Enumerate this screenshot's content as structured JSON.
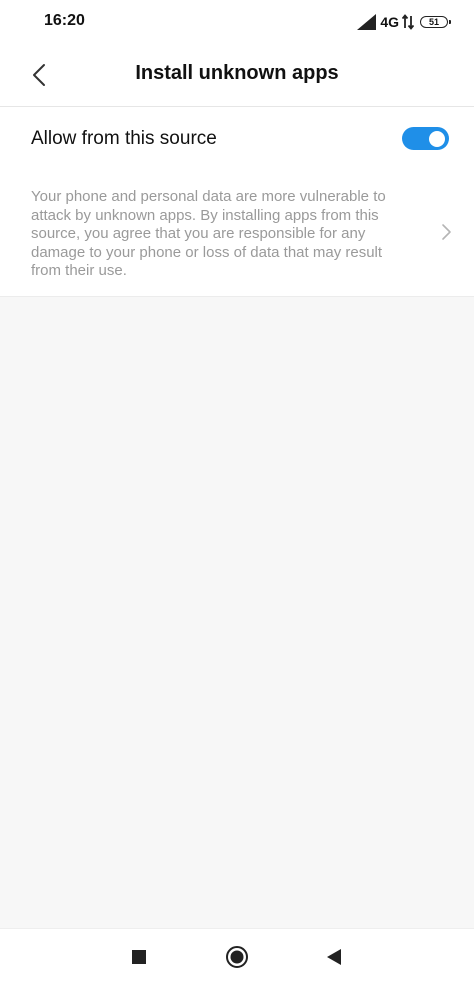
{
  "status_bar": {
    "time": "16:20",
    "network": "4G",
    "battery": "51"
  },
  "header": {
    "title": "Install unknown apps",
    "back_icon": "chevron-left-icon"
  },
  "settings": {
    "toggle_label": "Allow from this source",
    "toggle_on": true,
    "toggle_color": "#1f8fe8",
    "warning_text": "Your phone and personal data are more vulnerable to attack by unknown apps. By installing apps from this source, you agree that you are responsible for any damage to your phone or loss of data that may result from their use."
  },
  "nav_bar": {
    "icons": [
      "square-recents-icon",
      "circle-home-icon",
      "triangle-back-icon"
    ]
  }
}
